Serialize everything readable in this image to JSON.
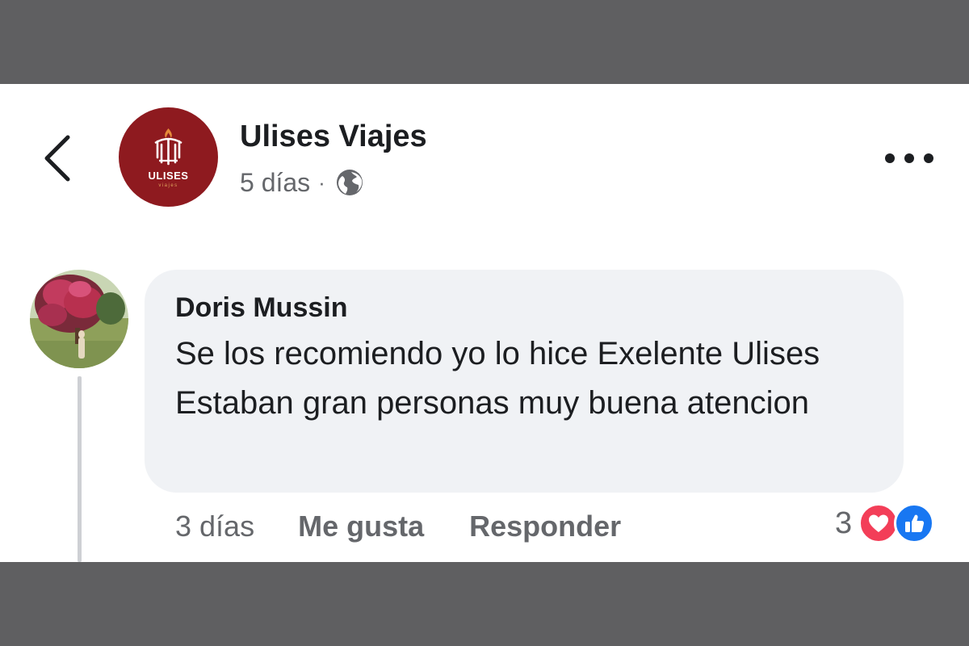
{
  "colors": {
    "band": "#5f5f61",
    "page_avatar_bg": "#8e1a1f",
    "bubble_bg": "#f0f2f5",
    "text_primary": "#1c1e21",
    "text_secondary": "#65676b",
    "love_reaction": "#f33e58",
    "like_reaction": "#1877f2"
  },
  "header": {
    "back_icon": "chevron-left-icon",
    "page_name": "Ulises Viajes",
    "page_avatar": {
      "name": "ULISES",
      "sub": "viajes"
    },
    "time": "5 días",
    "separator": "·",
    "privacy_icon": "globe-icon",
    "more_icon": "more-horizontal-icon"
  },
  "comment": {
    "author": "Doris Mussin",
    "text": "Se los recomiendo yo lo hice Exelente Ulises Estaban gran personas muy buena atencion",
    "time": "3 días",
    "like_label": "Me gusta",
    "reply_label": "Responder",
    "reaction_count": "3",
    "reaction_icons": [
      "heart-icon",
      "thumbs-up-icon"
    ]
  }
}
